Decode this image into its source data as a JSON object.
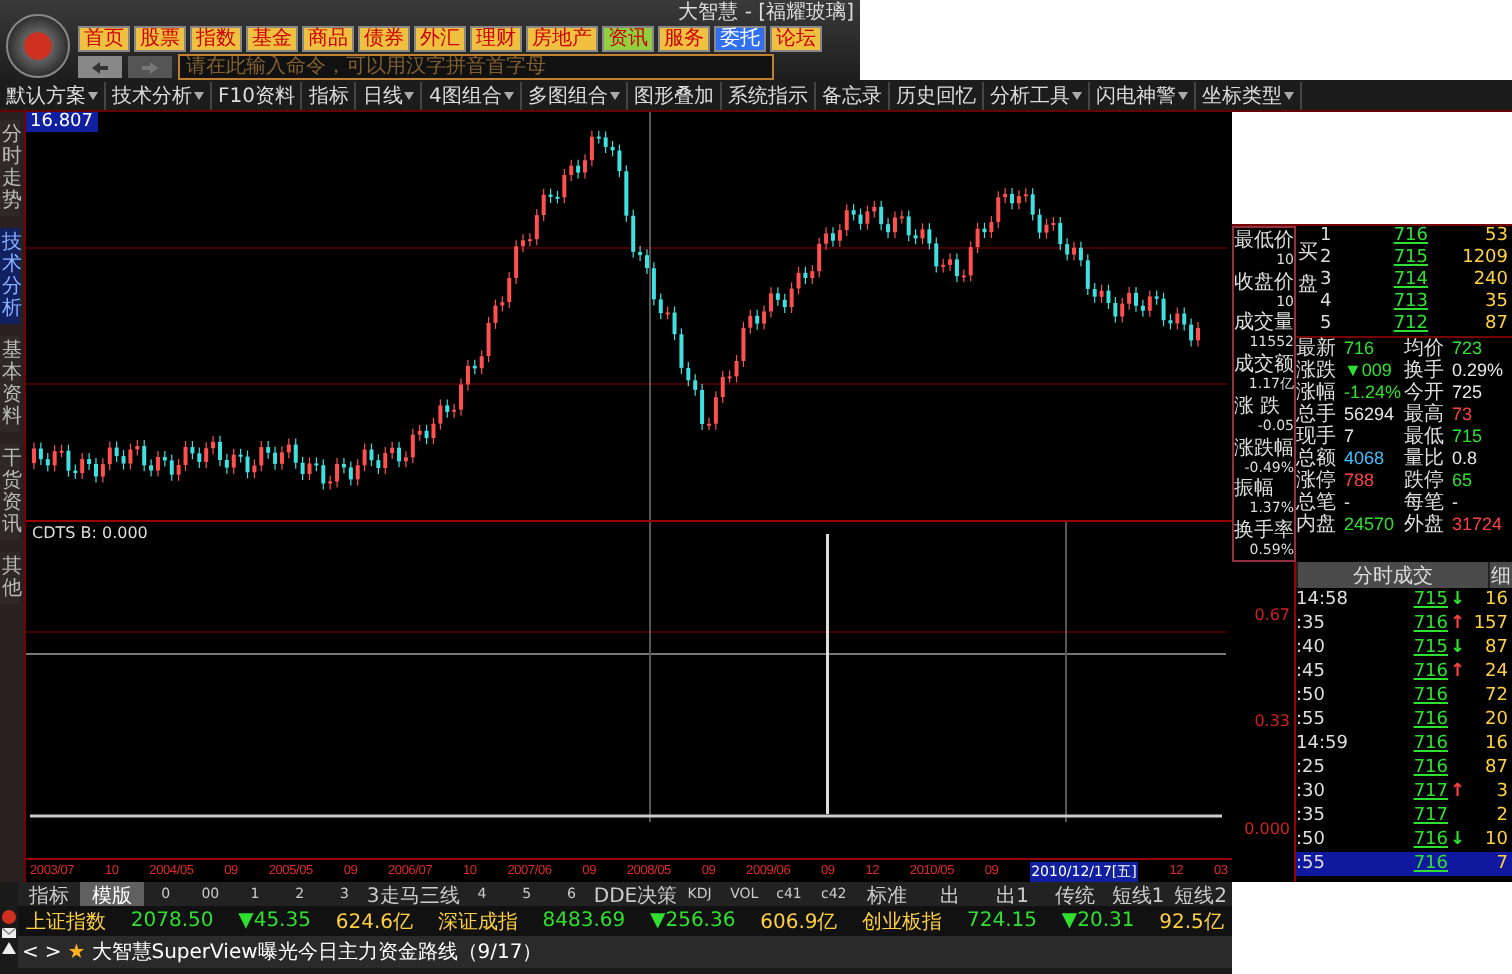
{
  "window": {
    "title": "大智慧 - [福耀玻璃]"
  },
  "nav_buttons": [
    {
      "label": "首页",
      "kind": "nav"
    },
    {
      "label": "股票",
      "kind": "nav"
    },
    {
      "label": "指数",
      "kind": "nav"
    },
    {
      "label": "基金",
      "kind": "nav"
    },
    {
      "label": "商品",
      "kind": "nav"
    },
    {
      "label": "债券",
      "kind": "nav"
    },
    {
      "label": "外汇",
      "kind": "nav"
    },
    {
      "label": "理财",
      "kind": "nav"
    },
    {
      "label": "房地产",
      "kind": "nav"
    },
    {
      "label": "资讯",
      "kind": "info"
    },
    {
      "label": "服务",
      "kind": "nav"
    },
    {
      "label": "委托",
      "kind": "trade"
    },
    {
      "label": "论坛",
      "kind": "nav"
    }
  ],
  "command": {
    "placeholder": "请在此输入命令，可以用汉字拼音首字母"
  },
  "menu": [
    {
      "label": "默认方案",
      "dropdown": true
    },
    {
      "label": "技术分析",
      "dropdown": true
    },
    {
      "label": "F10资料",
      "dropdown": false
    },
    {
      "label": "指标",
      "dropdown": false
    },
    {
      "label": "日线",
      "dropdown": true
    },
    {
      "label": "4图组合",
      "dropdown": true
    },
    {
      "label": "多图组合",
      "dropdown": true
    },
    {
      "label": "图形叠加",
      "dropdown": false
    },
    {
      "label": "系统指示",
      "dropdown": false
    },
    {
      "label": "备忘录",
      "dropdown": false
    },
    {
      "label": "历史回忆",
      "dropdown": false
    },
    {
      "label": "分析工具",
      "dropdown": true
    },
    {
      "label": "闪电神警",
      "dropdown": true
    },
    {
      "label": "坐标类型",
      "dropdown": true
    }
  ],
  "side_tabs": [
    {
      "label": "分时走势",
      "selected": false
    },
    {
      "label": "技术分析",
      "selected": true
    },
    {
      "label": "基本资料",
      "selected": false
    },
    {
      "label": "干货资讯",
      "selected": false
    },
    {
      "label": "其他",
      "selected": false
    }
  ],
  "chart": {
    "price_label": "16.807",
    "indicator_label": "CDTS B: 0.000",
    "axis_labels": [
      "0.67",
      "0.33",
      "0.000"
    ],
    "time_labels": [
      "2003/07",
      "10",
      "2004/05",
      "09",
      "2005/05",
      "09",
      "2006/07",
      "10",
      "2007/06",
      "09",
      "2008/05",
      "09",
      "2009/06",
      "09",
      "12",
      "2010/05",
      "09"
    ],
    "cursor_date": "2010/12/17[五]",
    "time_labels_end": [
      "12",
      "03"
    ]
  },
  "data_window": [
    {
      "label": "最低价",
      "value": "10"
    },
    {
      "label": "收盘价",
      "value": "10"
    },
    {
      "label": "成交量",
      "value": "11552"
    },
    {
      "label": "成交额",
      "value": "1.17亿"
    },
    {
      "label": "涨 跌",
      "value": "-0.05"
    },
    {
      "label": "涨跌幅",
      "value": "-0.49%"
    },
    {
      "label": "振幅",
      "value": "1.37%"
    },
    {
      "label": "换手率",
      "value": "0.59%"
    }
  ],
  "order_book": {
    "side_label": "买盘",
    "rows": [
      {
        "level": "1",
        "price": "716",
        "volume": "53"
      },
      {
        "level": "2",
        "price": "715",
        "volume": "1209"
      },
      {
        "level": "3",
        "price": "714",
        "volume": "240"
      },
      {
        "level": "4",
        "price": "713",
        "volume": "35"
      },
      {
        "level": "5",
        "price": "712",
        "volume": "87"
      }
    ]
  },
  "stats": [
    [
      {
        "label": "最新",
        "value": "716",
        "color": "#30e030"
      },
      {
        "label": "均价",
        "value": "723",
        "color": "#30e030"
      }
    ],
    [
      {
        "label": "涨跌",
        "value": "▼009",
        "color": "#30e030"
      },
      {
        "label": "换手",
        "value": "0.29%",
        "color": "#e8e8e8"
      }
    ],
    [
      {
        "label": "涨幅",
        "value": "-1.24%",
        "color": "#30e030"
      },
      {
        "label": "今开",
        "value": "725",
        "color": "#e8e8e8"
      }
    ],
    [
      {
        "label": "总手",
        "value": "56294",
        "color": "#e8e8e8"
      },
      {
        "label": "最高",
        "value": "73",
        "color": "#ff4040"
      }
    ],
    [
      {
        "label": "现手",
        "value": "7",
        "color": "#e8e8e8"
      },
      {
        "label": "最低",
        "value": "715",
        "color": "#30e030"
      }
    ],
    [
      {
        "label": "总额",
        "value": "4068",
        "color": "#40c0ff"
      },
      {
        "label": "量比",
        "value": "0.8",
        "color": "#e8e8e8"
      }
    ],
    [
      {
        "label": "涨停",
        "value": "788",
        "color": "#ff4040"
      },
      {
        "label": "跌停",
        "value": "65",
        "color": "#30e030"
      }
    ],
    [
      {
        "label": "总笔",
        "value": "-"
      },
      {
        "label": "每笔",
        "value": "-"
      }
    ],
    [
      {
        "label": "内盘",
        "value": "24570",
        "color": "#30e030"
      },
      {
        "label": "外盘",
        "value": "31724",
        "color": "#ff4040"
      }
    ]
  ],
  "ticks": {
    "tabs": [
      "分时成交",
      "细"
    ],
    "rows": [
      {
        "time": "14:58",
        "price": "715",
        "arrow": "↓",
        "color": "#30e030",
        "volume": "16",
        "selected": false
      },
      {
        "time": ":35",
        "price": "716",
        "arrow": "↑",
        "color": "#ff4040",
        "volume": "157",
        "selected": false
      },
      {
        "time": ":40",
        "price": "715",
        "arrow": "↓",
        "color": "#30e030",
        "volume": "87",
        "selected": false
      },
      {
        "time": ":45",
        "price": "716",
        "arrow": "↑",
        "color": "#ff4040",
        "volume": "24",
        "selected": false
      },
      {
        "time": ":50",
        "price": "716",
        "volume": "72",
        "selected": false
      },
      {
        "time": ":55",
        "price": "716",
        "volume": "20",
        "selected": false
      },
      {
        "time": "14:59",
        "price": "716",
        "volume": "16",
        "selected": false
      },
      {
        "time": ":25",
        "price": "716",
        "volume": "87",
        "selected": false
      },
      {
        "time": ":30",
        "price": "717",
        "arrow": "↑",
        "color": "#ff4040",
        "volume": "3",
        "selected": false
      },
      {
        "time": ":35",
        "price": "717",
        "volume": "2",
        "selected": false
      },
      {
        "time": ":50",
        "price": "716",
        "arrow": "↓",
        "color": "#30e030",
        "volume": "10",
        "selected": false
      },
      {
        "time": ":55",
        "price": "716",
        "volume": "7",
        "selected": true
      }
    ]
  },
  "indicator_tabs": [
    {
      "label": "指标",
      "selected": false
    },
    {
      "label": "模版",
      "selected": true
    },
    {
      "label": "0",
      "selected": false
    },
    {
      "label": "00",
      "selected": false
    },
    {
      "label": "1",
      "selected": false
    },
    {
      "label": "2",
      "selected": false
    },
    {
      "label": "3",
      "selected": false
    },
    {
      "label": "3走马三线",
      "selected": false
    },
    {
      "label": "4",
      "selected": false
    },
    {
      "label": "5",
      "selected": false
    },
    {
      "label": "6",
      "selected": false
    },
    {
      "label": "DDE决策",
      "selected": false
    },
    {
      "label": "KDJ",
      "selected": false
    },
    {
      "label": "VOL",
      "selected": false
    },
    {
      "label": "c41",
      "selected": false
    },
    {
      "label": "c42",
      "selected": false
    },
    {
      "label": "标准",
      "selected": false
    },
    {
      "label": "出",
      "selected": false
    },
    {
      "label": "出1",
      "selected": false
    },
    {
      "label": "传统",
      "selected": false
    },
    {
      "label": "短线1",
      "selected": false
    },
    {
      "label": "短线2",
      "selected": false
    }
  ],
  "market": [
    {
      "name": "上证指数",
      "value": "2078.50",
      "change": "▼45.35",
      "amount": "624.6亿",
      "color": "#30e030"
    },
    {
      "name": "深证成指",
      "value": "8483.69",
      "change": "▼256.36",
      "amount": "606.9亿",
      "color": "#30e030"
    },
    {
      "name": "创业板指",
      "value": "724.15",
      "change": "▼20.31",
      "amount": "92.5亿",
      "color": "#30e030"
    }
  ],
  "news": {
    "prev": "<",
    "next": ">",
    "star": "★",
    "headline": "大智慧SuperView曝光今日主力资金路线（9/17）"
  }
}
